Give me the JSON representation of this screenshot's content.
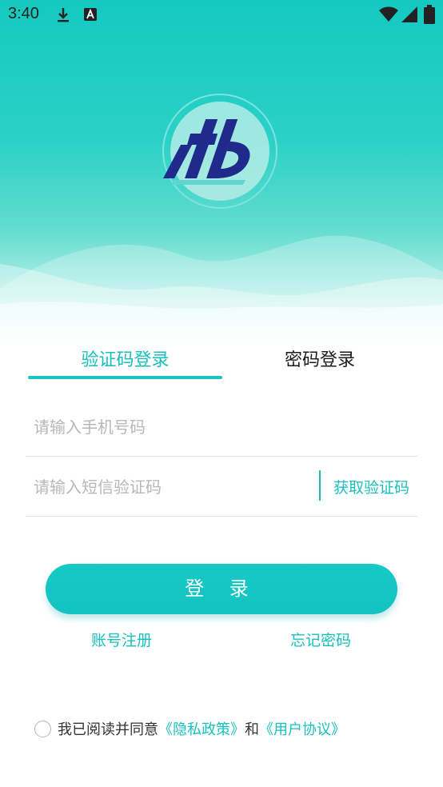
{
  "status_bar": {
    "time": "3:40",
    "icons": [
      "download-icon",
      "a-notification-icon",
      "wifi-icon",
      "signal-icon",
      "battery-icon"
    ]
  },
  "logo": {
    "name": "brand-logo"
  },
  "tabs": {
    "sms_login": "验证码登录",
    "password_login": "密码登录",
    "active": "sms_login"
  },
  "form": {
    "phone_placeholder": "请输入手机号码",
    "code_placeholder": "请输入短信验证码",
    "get_code": "获取验证码"
  },
  "actions": {
    "login": "登 录",
    "register": "账号注册",
    "forgot": "忘记密码"
  },
  "agreement": {
    "prefix": "我已阅读并同意",
    "privacy": "《隐私政策》",
    "and": "和",
    "user_agreement": "《用户协议》"
  },
  "colors": {
    "accent": "#19bfbf",
    "hero": "#14c9c1",
    "logo_blue": "#1e2a8c"
  }
}
